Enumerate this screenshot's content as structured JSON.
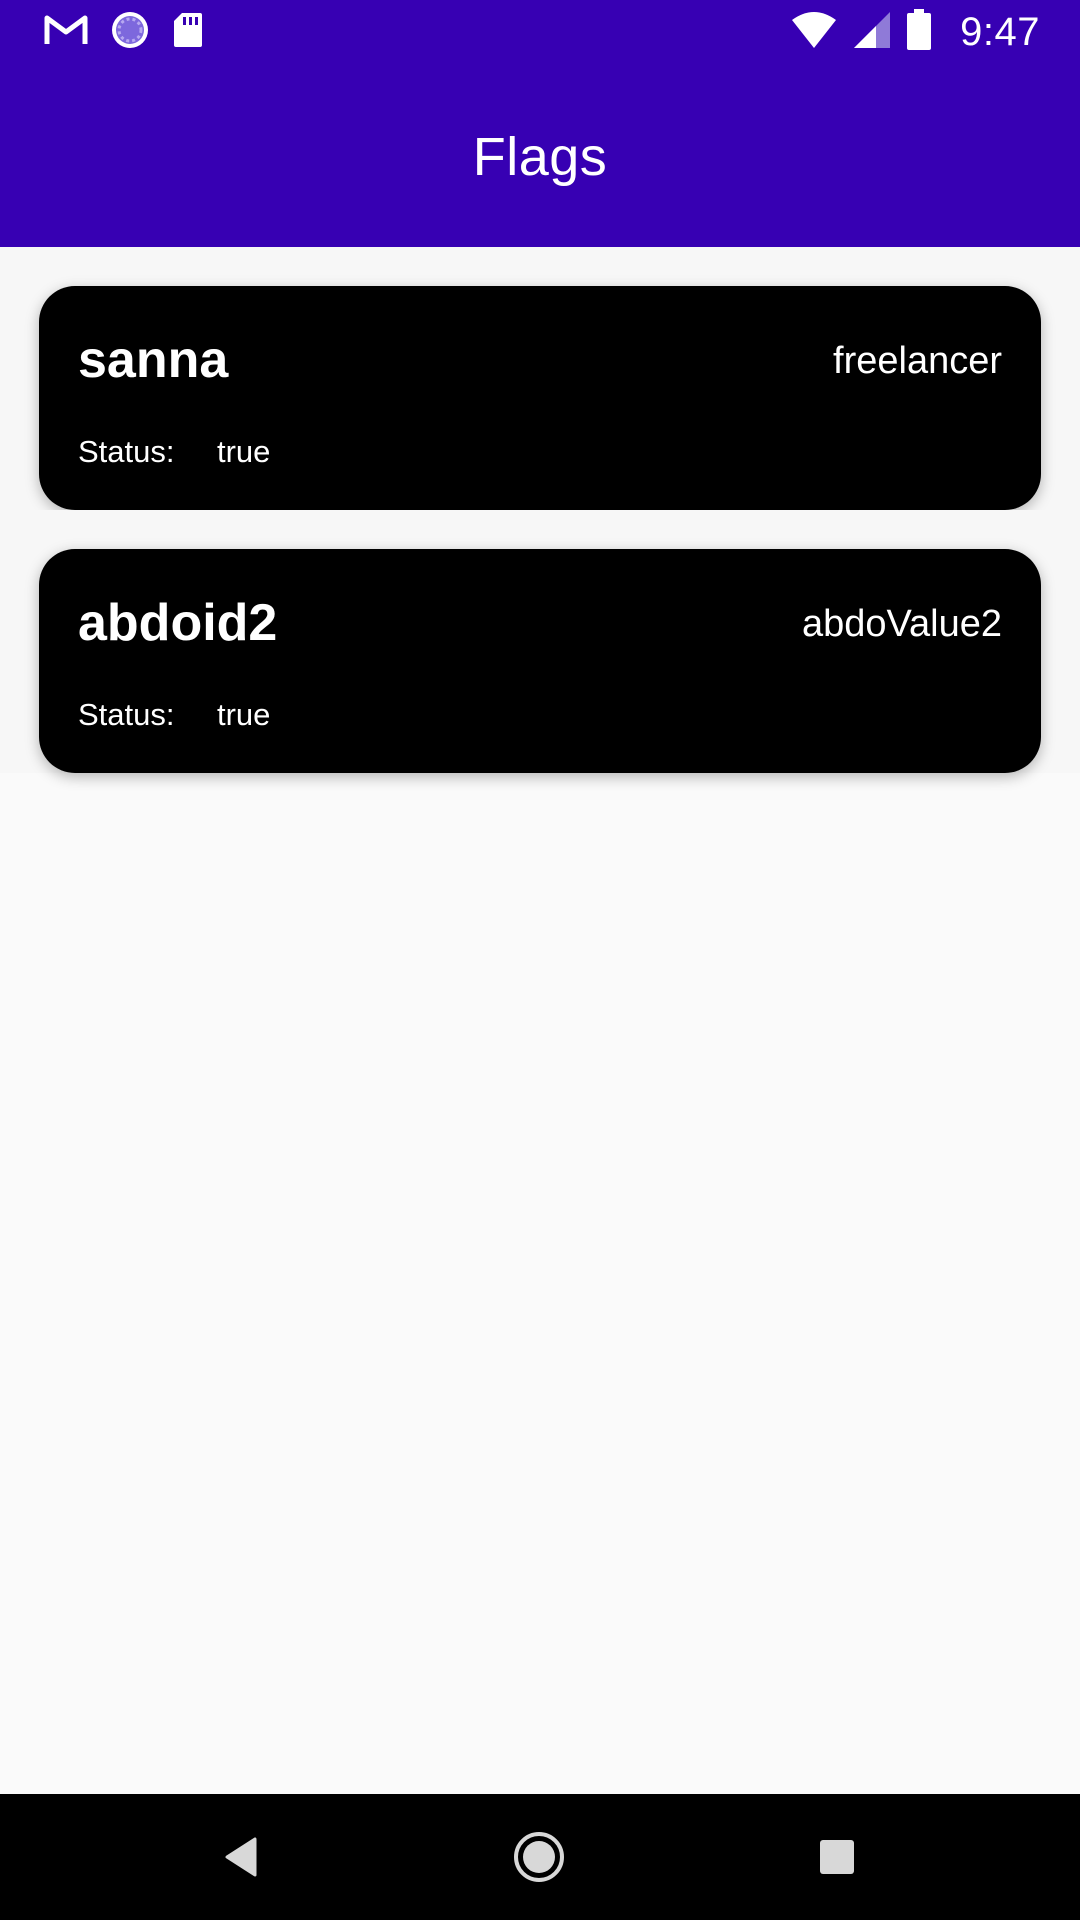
{
  "status_bar": {
    "time": "9:47",
    "icons_left": [
      "gmail-icon",
      "sync-icon",
      "sd-card-icon"
    ],
    "icons_right": [
      "wifi-icon",
      "signal-icon",
      "battery-icon"
    ]
  },
  "app_bar": {
    "title": "Flags"
  },
  "flags": [
    {
      "name": "sanna",
      "value": "freelancer",
      "status_label": "Status:",
      "status": "true"
    },
    {
      "name": "abdoid2",
      "value": "abdoValue2",
      "status_label": "Status:",
      "status": "true"
    }
  ],
  "nav_bar": {
    "buttons": [
      "back-icon",
      "home-icon",
      "recents-icon"
    ]
  },
  "colors": {
    "primary": "#3700b3",
    "card_background": "#000000",
    "screen_background": "#fafafa"
  }
}
